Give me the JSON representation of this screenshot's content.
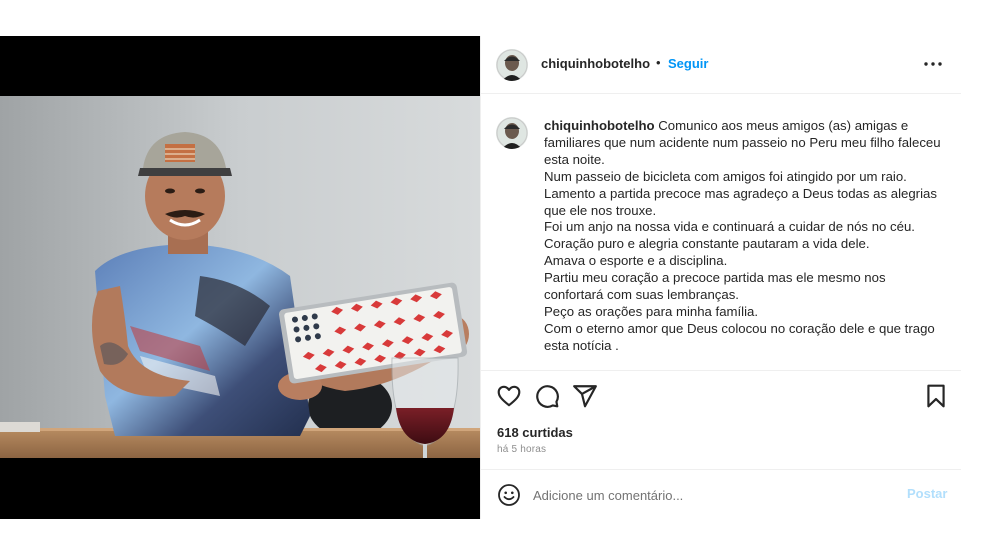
{
  "post": {
    "username": "chiquinhobotelho",
    "separator": "•",
    "follow_label": "Seguir",
    "more_icon": "more-horizontal-icon"
  },
  "caption": {
    "username": "chiquinhobotelho",
    "lines": [
      "Comunico aos meus amigos (as) amigas e",
      "familiares que num acidente num passeio no Peru meu filho faleceu",
      "esta noite.",
      "Num passeio de bicicleta com amigos foi atingido por um raio.",
      "Lamento a partida precoce mas agradeço a Deus todas as alegrias",
      "que ele nos trouxe.",
      "Foi um anjo na nossa vida e continuará a cuidar de nós no céu.",
      "Coração puro e alegria constante pautaram a vida dele.",
      "Amava o esporte e a disciplina.",
      "Partiu meu coração a precoce partida mas ele mesmo nos",
      "confortará com suas lembranças.",
      "Peço as orações para minha família.",
      "Com o eterno amor que Deus colocou no coração dele e que trago",
      "esta notícia ."
    ]
  },
  "actions": {
    "icons": [
      "heart-icon",
      "comment-icon",
      "share-icon",
      "bookmark-icon"
    ]
  },
  "likes_text": "618 curtidas",
  "time_text": "há 5 horas",
  "comment_box": {
    "placeholder": "Adicione um comentário...",
    "post_label": "Postar",
    "emoji_icon": "emoji-icon"
  },
  "colors": {
    "link_blue": "#0095f6",
    "post_disabled": "#b2dffc",
    "text": "#262626",
    "muted": "#8e8e8e",
    "border": "#efefef"
  }
}
